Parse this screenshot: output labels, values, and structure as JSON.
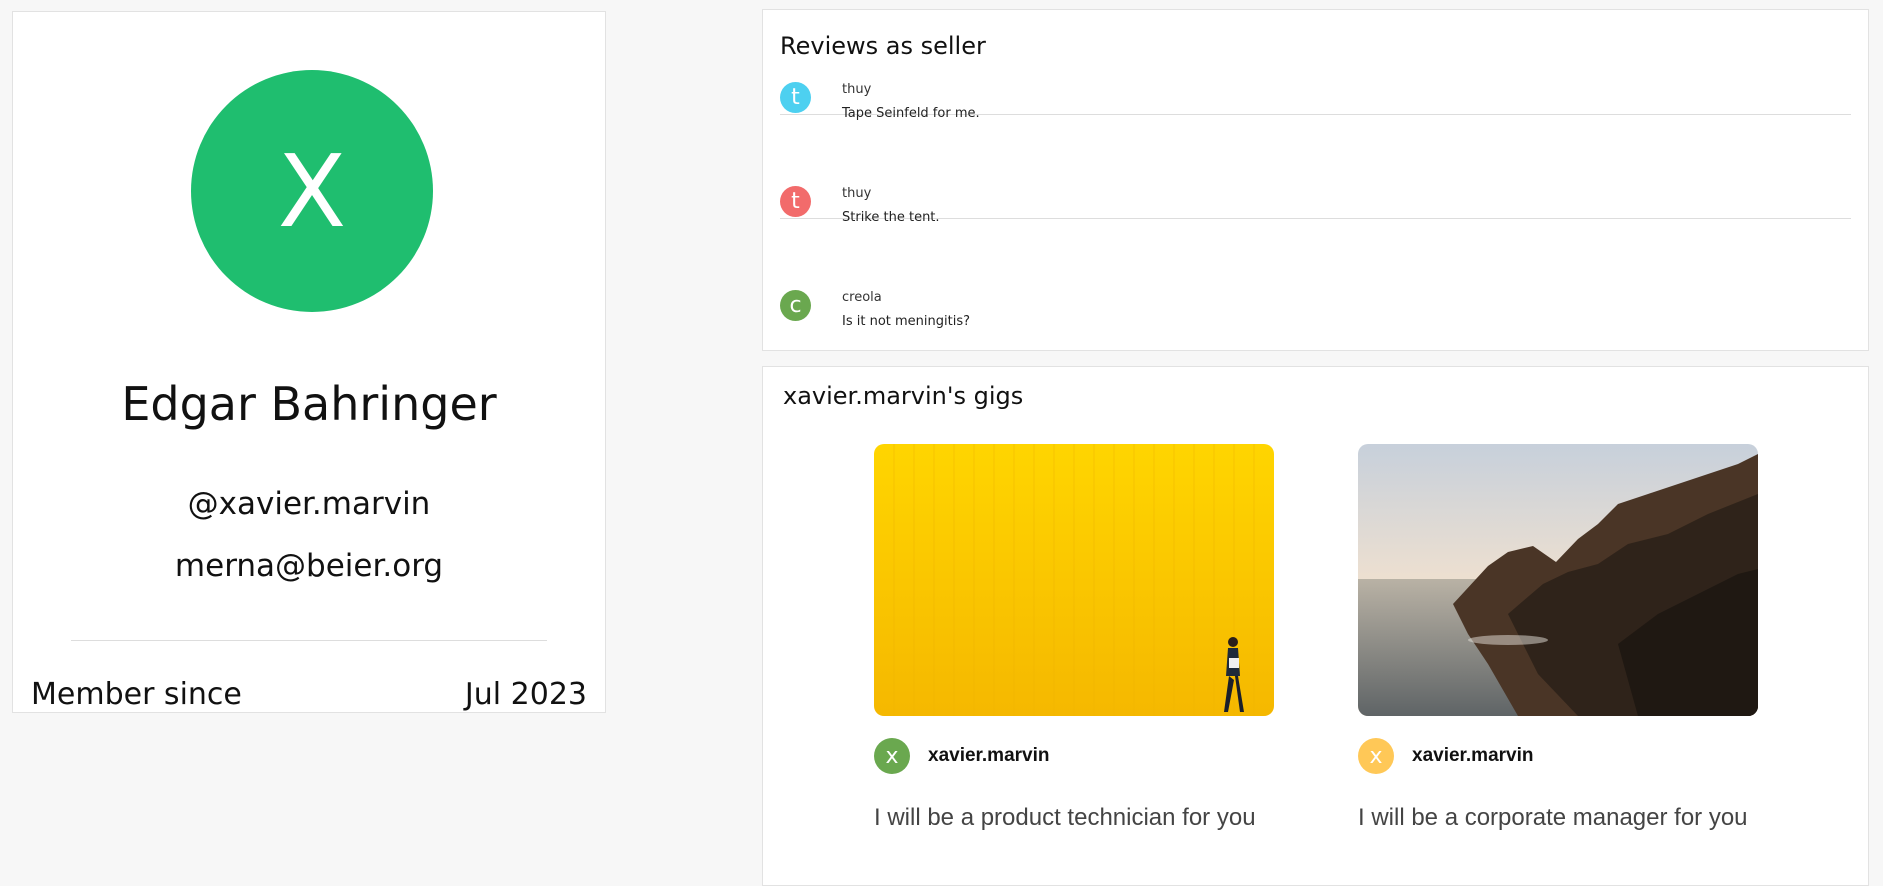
{
  "profile": {
    "avatar_letter": "X",
    "avatar_color": "#1fbe6f",
    "name": "Edgar Bahringer",
    "handle": "@xavier.marvin",
    "email": "merna@beier.org",
    "member_label": "Member since",
    "member_date": "Jul 2023"
  },
  "reviews": {
    "title": "Reviews as seller",
    "items": [
      {
        "letter": "t",
        "color": "#4dd0f0",
        "user": "thuy",
        "text": "Tape Seinfeld for me."
      },
      {
        "letter": "t",
        "color": "#f26b6b",
        "user": "thuy",
        "text": "Strike the tent."
      },
      {
        "letter": "c",
        "color": "#6aa84f",
        "user": "creola",
        "text": "Is it not meningitis?"
      }
    ]
  },
  "gigs": {
    "title": "xavier.marvin's gigs",
    "items": [
      {
        "author": "xavier.marvin",
        "author_letter": "x",
        "author_color": "#6aa84f",
        "title": "I will be a product technician for you",
        "image": "yellow-wall-photo"
      },
      {
        "author": "xavier.marvin",
        "author_letter": "x",
        "author_color": "#ffc857",
        "title": "I will be a corporate manager for you",
        "image": "coastal-cliff-photo"
      }
    ]
  }
}
